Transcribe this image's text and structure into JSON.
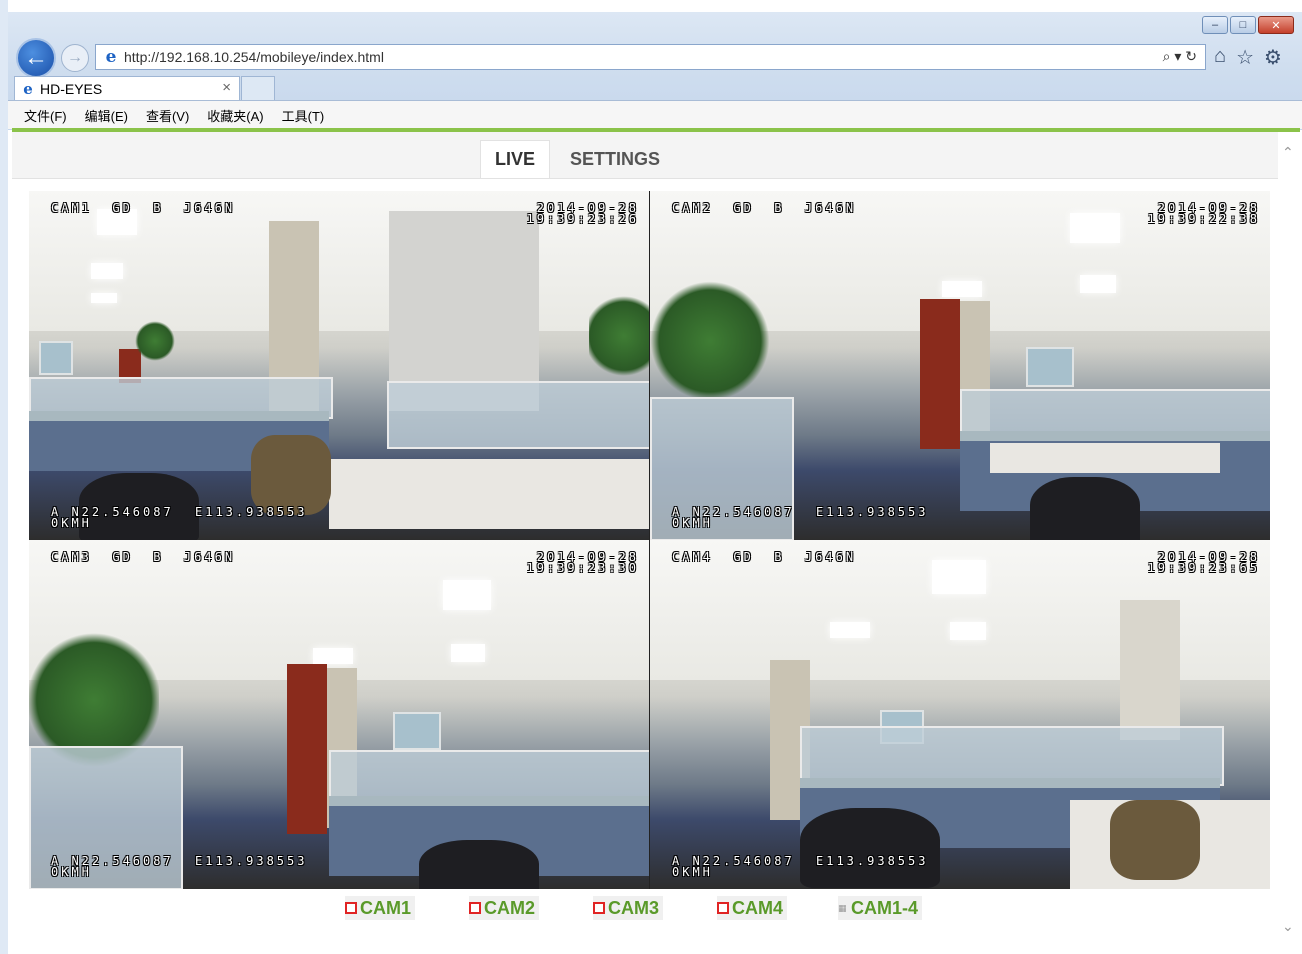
{
  "browser": {
    "url": "http://192.168.10.254/mobileye/index.html",
    "url_tools": "⌕ ▾ ↻",
    "tab_title": "HD-EYES",
    "tab_close": "×",
    "window_buttons": {
      "minimize": "–",
      "maximize": "□",
      "close": "✕"
    },
    "nav_icons": {
      "home": "⌂",
      "favorites": "☆",
      "settings": "⚙"
    },
    "menu": [
      "文件(F)",
      "编辑(E)",
      "查看(V)",
      "收藏夹(A)",
      "工具(T)"
    ]
  },
  "page": {
    "tabs": {
      "live": "LIVE",
      "settings": "SETTINGS"
    },
    "cameras": [
      {
        "label": "CAM1  GD  B  J646N",
        "date": "2014-09-28",
        "time": "19:39:23:26",
        "lat": "A N22.546087",
        "lon": "E113.938553",
        "speed": "0KMH"
      },
      {
        "label": "CAM2  GD  B  J646N",
        "date": "2014-09-28",
        "time": "19:39:22:38",
        "lat": "A N22.546087",
        "lon": "E113.938553",
        "speed": "0KMH"
      },
      {
        "label": "CAM3  GD  B  J646N",
        "date": "2014-09-28",
        "time": "19:39:23:30",
        "lat": "A N22.546087",
        "lon": "E113.938553",
        "speed": "0KMH"
      },
      {
        "label": "CAM4  GD  B  J646N",
        "date": "2014-09-28",
        "time": "19:39:23:65",
        "lat": "A N22.546087",
        "lon": "E113.938553",
        "speed": "0KMH"
      }
    ],
    "cam_buttons": [
      "CAM1",
      "CAM2",
      "CAM3",
      "CAM4",
      "CAM1-4"
    ]
  },
  "colors": {
    "accent": "#8bc34a",
    "cam_button_text": "#5a9a2a",
    "record_indicator": "#e02424"
  }
}
